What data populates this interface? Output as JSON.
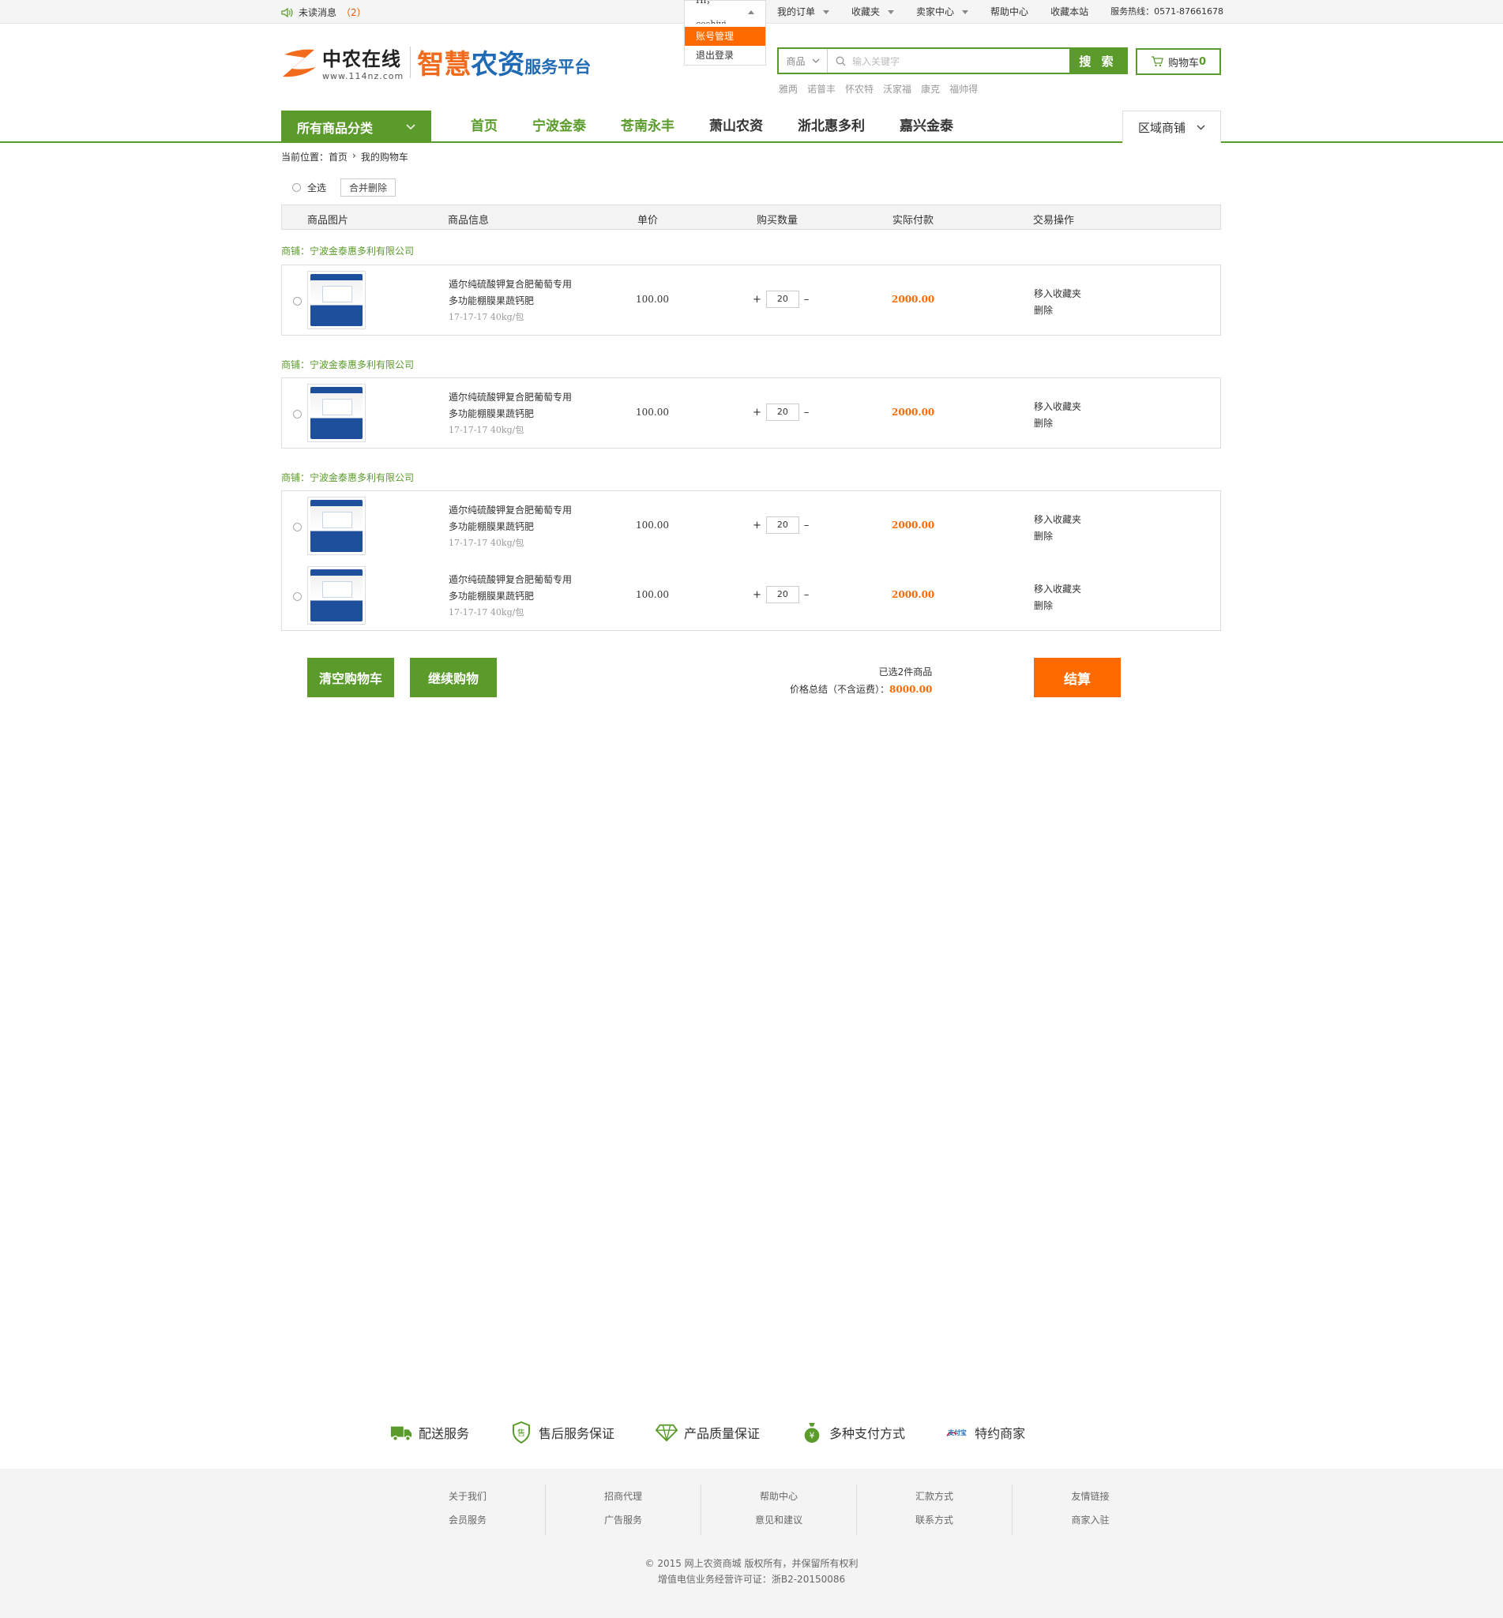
{
  "topbar": {
    "unread_label": "未读消息",
    "unread_count": "（2）",
    "user_greeting": "Hi，ceshiyi",
    "user_menu": [
      "账号管理",
      "退出登录"
    ],
    "links": [
      {
        "label": "我的订单",
        "dropdown": true
      },
      {
        "label": "收藏夹",
        "dropdown": true
      },
      {
        "label": "卖家中心",
        "dropdown": true
      },
      {
        "label": "帮助中心",
        "dropdown": false
      },
      {
        "label": "收藏本站",
        "dropdown": false
      }
    ],
    "hotline": "服务热线：0571-87661678"
  },
  "header": {
    "logo_name": "中农在线",
    "logo_url": "www.114nz.com",
    "slogan_part1": "智慧",
    "slogan_part2": "农资",
    "slogan_part3": "服务平台",
    "search_category": "商品",
    "search_placeholder": "输入关键字",
    "search_button": "搜 索",
    "cart_label": "购物车",
    "cart_count": "0",
    "hot_words": [
      "雅两",
      "诺普丰",
      "怀农特",
      "沃家福",
      "康克",
      "福帅得"
    ]
  },
  "nav": {
    "all_categories": "所有商品分类",
    "links": [
      {
        "label": "首页",
        "highlight": true
      },
      {
        "label": "宁波金泰",
        "highlight": true
      },
      {
        "label": "苍南永丰",
        "highlight": true
      },
      {
        "label": "萧山农资",
        "highlight": false
      },
      {
        "label": "浙北惠多利",
        "highlight": false
      },
      {
        "label": "嘉兴金泰",
        "highlight": false
      }
    ],
    "region": "区域商铺"
  },
  "breadcrumb": {
    "prefix": "当前位置：",
    "home": "首页",
    "current": "我的购物车"
  },
  "cart": {
    "select_all": "全选",
    "merge_delete": "合并删除",
    "columns": [
      "商品图片",
      "商品信息",
      "单价",
      "购买数量",
      "实际付款",
      "交易操作"
    ],
    "groups": [
      {
        "store": "商铺：宁波金泰惠多利有限公司",
        "items": [
          {
            "name": "遁尔纯硫酸钾复合肥葡萄专用多功能棚膜果蔬钙肥",
            "spec": "17-17-17  40kg/包",
            "price": "100.00",
            "qty": "20",
            "pay": "2000.00",
            "op1": "移入收藏夹",
            "op2": "删除"
          }
        ]
      },
      {
        "store": "商铺：宁波金泰惠多利有限公司",
        "items": [
          {
            "name": "遁尔纯硫酸钾复合肥葡萄专用多功能棚膜果蔬钙肥",
            "spec": "17-17-17  40kg/包",
            "price": "100.00",
            "qty": "20",
            "pay": "2000.00",
            "op1": "移入收藏夹",
            "op2": "删除"
          }
        ]
      },
      {
        "store": "商铺：宁波金泰惠多利有限公司",
        "items": [
          {
            "name": "遁尔纯硫酸钾复合肥葡萄专用多功能棚膜果蔬钙肥",
            "spec": "17-17-17  40kg/包",
            "price": "100.00",
            "qty": "20",
            "pay": "2000.00",
            "op1": "移入收藏夹",
            "op2": "删除"
          },
          {
            "name": "遁尔纯硫酸钾复合肥葡萄专用多功能棚膜果蔬钙肥",
            "spec": "17-17-17  40kg/包",
            "price": "100.00",
            "qty": "20",
            "pay": "2000.00",
            "op1": "移入收藏夹",
            "op2": "删除"
          }
        ]
      }
    ],
    "clear_button": "清空购物车",
    "continue_button": "继续购物",
    "selected_text": "已选2件商品",
    "total_label": "价格总结（不含运费）：",
    "total_value": "8000.00",
    "checkout_button": "结算"
  },
  "services": [
    "配送服务",
    "售后服务保证",
    "产品质量保证",
    "多种支付方式",
    "特约商家"
  ],
  "services_alipay_text": "支付宝",
  "footer": {
    "columns": [
      [
        "关于我们",
        "会员服务"
      ],
      [
        "招商代理",
        "广告服务"
      ],
      [
        "帮助中心",
        "意见和建议"
      ],
      [
        "汇款方式",
        "联系方式"
      ],
      [
        "友情链接",
        "商家入驻"
      ]
    ],
    "copyright": "© 2015 网上农资商城 版权所有，并保留所有权利",
    "license": "增值电信业务经营许可证：浙B2-20150086"
  },
  "colors": {
    "green": "#5a9b2c",
    "orange": "#ff6a00",
    "blue": "#1f6bb5"
  }
}
